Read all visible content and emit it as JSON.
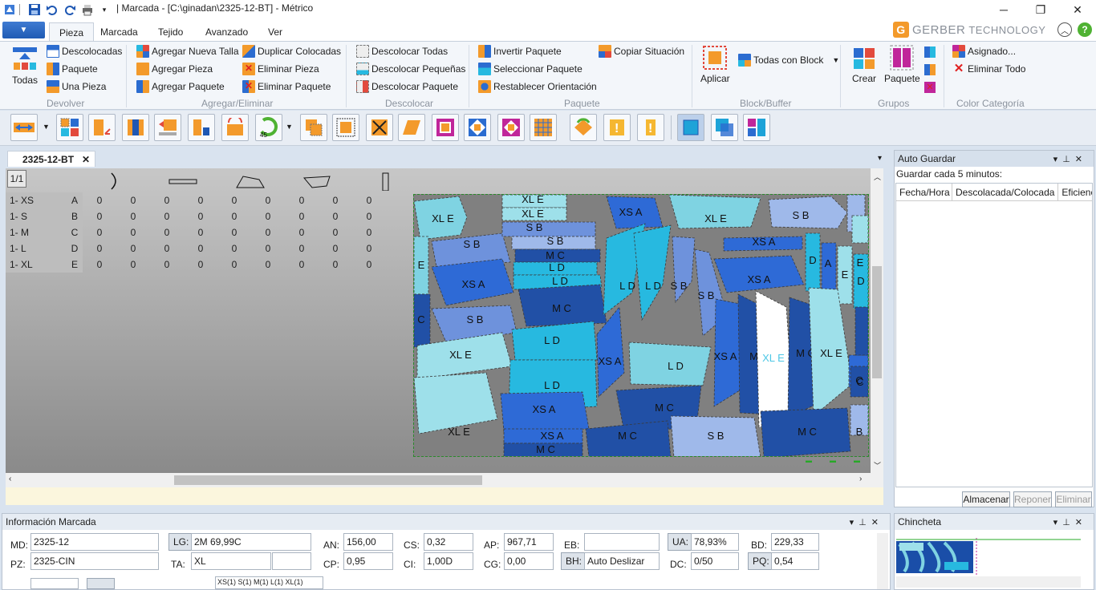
{
  "window": {
    "title": "| Marcada - [C:\\ginadan\\2325-12-BT] - Métrico"
  },
  "ribbon_tabs": [
    "Pieza",
    "Marcada",
    "Tejido",
    "Avanzado",
    "Ver"
  ],
  "brand": {
    "name": "GERBER",
    "suffix": "TECHNOLOGY"
  },
  "ribbon": {
    "devolver": {
      "big": "Todas",
      "items": [
        "Descolocadas",
        "Paquete",
        "Una Pieza"
      ],
      "label": "Devolver"
    },
    "agregar": {
      "items": [
        "Agregar Nueva Talla",
        "Agregar Pieza",
        "Agregar Paquete",
        "Duplicar Colocadas",
        "Eliminar Pieza",
        "Eliminar Paquete"
      ],
      "label": "Agregar/Eliminar"
    },
    "descolocar": {
      "items": [
        "Descolocar Todas",
        "Descolocar Pequeñas",
        "Descolocar Paquete"
      ],
      "label": "Descolocar"
    },
    "paquete": {
      "items": [
        "Invertir Paquete",
        "Seleccionar Paquete",
        "Restablecer Orientación",
        "Copiar Situación"
      ],
      "label": "Paquete"
    },
    "block": {
      "big": "Aplicar",
      "dropdown": "Todas con Block",
      "label": "Block/Buffer"
    },
    "grupos": {
      "items": [
        "Crear",
        "Paquete"
      ],
      "label": "Grupos"
    },
    "color": {
      "items": [
        "Asignado...",
        "Eliminar Todo"
      ],
      "label": "Color Categoría"
    }
  },
  "document_tab": {
    "label": "2325-12-BT"
  },
  "page_indicator": "1/1",
  "size_grid": {
    "rows": [
      {
        "size": "1- XS",
        "code": "A",
        "values": [
          "0",
          "0",
          "0",
          "0",
          "0",
          "0",
          "0",
          "0",
          "0"
        ]
      },
      {
        "size": "1- S",
        "code": "B",
        "values": [
          "0",
          "0",
          "0",
          "0",
          "0",
          "0",
          "0",
          "0",
          "0"
        ]
      },
      {
        "size": "1- M",
        "code": "C",
        "values": [
          "0",
          "0",
          "0",
          "0",
          "0",
          "0",
          "0",
          "0",
          "0"
        ]
      },
      {
        "size": "1- L",
        "code": "D",
        "values": [
          "0",
          "0",
          "0",
          "0",
          "0",
          "0",
          "0",
          "0",
          "0"
        ]
      },
      {
        "size": "1- XL",
        "code": "E",
        "values": [
          "0",
          "0",
          "0",
          "0",
          "0",
          "0",
          "0",
          "0",
          "0"
        ]
      }
    ]
  },
  "marker_pieces": [
    {
      "label": "XL E",
      "color": "#7fd3e2"
    },
    {
      "label": "XL E",
      "color": "#9ee0ea"
    },
    {
      "label": "XL E",
      "color": "#9ee0ea"
    },
    {
      "label": "S B",
      "color": "#9fb9ea"
    },
    {
      "label": "XS A",
      "color": "#2e6ad6"
    },
    {
      "label": "XL E",
      "color": "#7fd3e2"
    },
    {
      "label": "S B",
      "color": "#6e92dc"
    },
    {
      "label": "B",
      "color": "#9fb9ea"
    },
    {
      "label": "S B",
      "color": "#6e92dc"
    },
    {
      "label": "S B",
      "color": "#9fb9ea"
    },
    {
      "label": "M C",
      "color": "#2150a6"
    },
    {
      "label": "L D",
      "color": "#27b9e0"
    },
    {
      "label": "L D",
      "color": "#27b9e0"
    },
    {
      "label": "XS A",
      "color": "#2e6ad6"
    },
    {
      "label": "E",
      "color": "#7fd3e2"
    },
    {
      "label": "XS A",
      "color": "#2e6ad6"
    },
    {
      "label": "M C",
      "color": "#2150a6"
    },
    {
      "label": "L D",
      "color": "#27b9e0"
    },
    {
      "label": "L D",
      "color": "#27b9e0"
    },
    {
      "label": "S B",
      "color": "#6e92dc"
    },
    {
      "label": "S B",
      "color": "#6e92dc"
    },
    {
      "label": "XS A",
      "color": "#2e6ad6"
    },
    {
      "label": "D",
      "color": "#27b9e0"
    },
    {
      "label": "A",
      "color": "#2e6ad6"
    },
    {
      "label": "E",
      "color": "#9ee0ea"
    },
    {
      "label": "D",
      "color": "#27b9e0"
    },
    {
      "label": "C",
      "color": "#2150a6"
    },
    {
      "label": "S B",
      "color": "#6e92dc"
    },
    {
      "label": "XL E",
      "color": "#9ee0ea"
    },
    {
      "label": "L D",
      "color": "#27b9e0"
    },
    {
      "label": "XS A",
      "color": "#2e6ad6"
    },
    {
      "label": "L D",
      "color": "#7fd3e2"
    },
    {
      "label": "XS A",
      "color": "#2e6ad6"
    },
    {
      "label": "M C",
      "color": "#2150a6"
    },
    {
      "label": "XL E",
      "color": "#ffffff"
    },
    {
      "label": "M C",
      "color": "#2150a6"
    },
    {
      "label": "XL E",
      "color": "#9ee0ea"
    },
    {
      "label": "A",
      "color": "#2e6ad6"
    },
    {
      "label": "L D",
      "color": "#27b9e0"
    },
    {
      "label": "M C",
      "color": "#2150a6"
    },
    {
      "label": "C",
      "color": "#2150a6"
    },
    {
      "label": "XL E",
      "color": "#9ee0ea"
    },
    {
      "label": "XS A",
      "color": "#2e6ad6"
    },
    {
      "label": "XS A",
      "color": "#2e6ad6"
    },
    {
      "label": "M C",
      "color": "#2150a6"
    },
    {
      "label": "M C",
      "color": "#2150a6"
    },
    {
      "label": "S B",
      "color": "#9fb9ea"
    },
    {
      "label": "M C",
      "color": "#2150a6"
    },
    {
      "label": "B",
      "color": "#9fb9ea"
    },
    {
      "label": "E",
      "color": "#9ee0ea"
    },
    {
      "label": "C",
      "color": "#2150a6"
    }
  ],
  "auto_guardar": {
    "title": "Auto Guardar",
    "subtitle": "Guardar cada 5 minutos:",
    "columns": [
      "Fecha/Hora",
      "Descolacada/Colocada",
      "Eficienc"
    ],
    "buttons": [
      "Almacenar",
      "Reponer",
      "Eliminar"
    ]
  },
  "info_marcada": {
    "title": "Información Marcada",
    "MD": "2325-12",
    "PZ": "2325-CIN",
    "LG": "2M 69,99C",
    "TA": "XL",
    "AN": "156,00",
    "CP": "0,95",
    "CS": "0,32",
    "CI": "1,00D",
    "AP": "967,71",
    "CG": "0,00",
    "EB": "",
    "BH": "Auto Deslizar",
    "UA": "78,93%",
    "DC": "0/50",
    "BD": "229,33",
    "PQ": "0,54",
    "sizes_clip": "XS(1) S(1) M(1) L(1) XL(1)"
  },
  "chincheta": {
    "title": "Chincheta"
  },
  "colors": {
    "accent": "#2b6cd0",
    "marker_bg": "#808080",
    "selected_piece": "#ffffff"
  }
}
